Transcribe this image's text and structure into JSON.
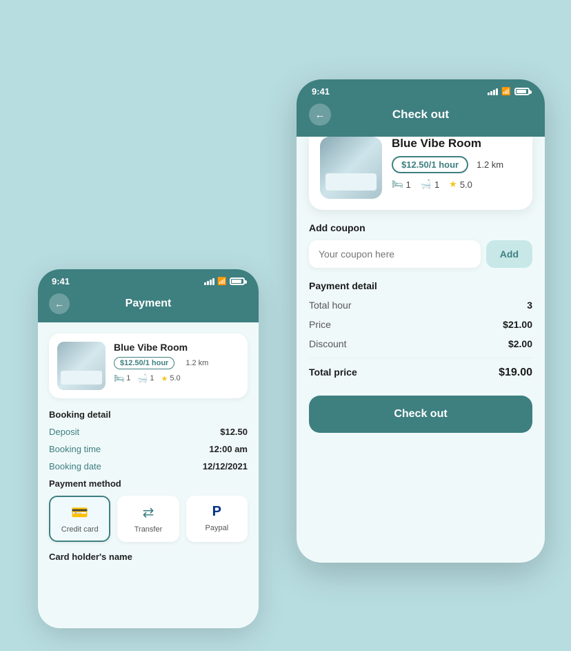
{
  "background_color": "#b8dde1",
  "phone_back": {
    "status_time": "9:41",
    "header_title": "Payment",
    "room": {
      "name": "Blue Vibe Room",
      "price": "$12.50/1 hour",
      "distance": "1.2 km",
      "beds": "1",
      "baths": "1",
      "rating": "5.0"
    },
    "booking_detail": {
      "title": "Booking detail",
      "deposit_label": "Deposit",
      "deposit_value": "$12.50",
      "booking_time_label": "Booking time",
      "booking_time_value": "12:00 am",
      "booking_date_label": "Booking date",
      "booking_date_value": "12/12/2021"
    },
    "payment_method": {
      "title": "Payment method",
      "methods": [
        {
          "id": "credit",
          "label": "Credit card",
          "active": true
        },
        {
          "id": "transfer",
          "label": "Transfer",
          "active": false
        },
        {
          "id": "paypal",
          "label": "Paypal",
          "active": false
        }
      ]
    },
    "card_holder_label": "Card holder's name"
  },
  "phone_front": {
    "status_time": "9:41",
    "header_title": "Check out",
    "room": {
      "name": "Blue Vibe Room",
      "price": "$12.50/1 hour",
      "distance": "1.2 km",
      "beds": "1",
      "baths": "1",
      "rating": "5.0"
    },
    "coupon": {
      "label": "Add coupon",
      "placeholder": "Your coupon here",
      "add_button": "Add"
    },
    "payment_detail": {
      "title": "Payment detail",
      "total_hour_label": "Total hour",
      "total_hour_value": "3",
      "price_label": "Price",
      "price_value": "$21.00",
      "discount_label": "Discount",
      "discount_value": "$2.00",
      "total_price_label": "Total price",
      "total_price_value": "$19.00"
    },
    "checkout_button": "Check out"
  }
}
